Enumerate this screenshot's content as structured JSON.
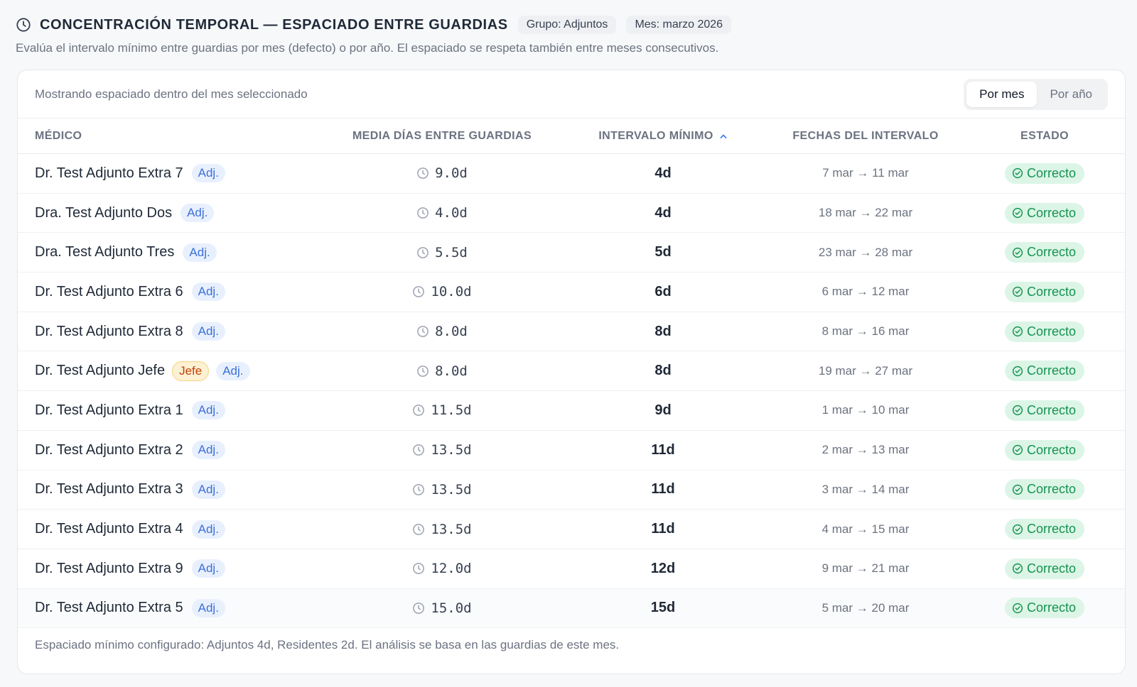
{
  "header": {
    "title": "Concentración temporal — Espaciado entre guardias",
    "group_pill": "Grupo: Adjuntos",
    "month_pill": "Mes: marzo 2026",
    "subtitle": "Evalúa el intervalo mínimo entre guardias por mes (defecto) o por año. El espaciado se respeta también entre meses consecutivos."
  },
  "card": {
    "info": "Mostrando espaciado dentro del mes seleccionado",
    "toggle": {
      "month_label": "Por mes",
      "year_label": "Por año",
      "selected": "Por mes"
    }
  },
  "table": {
    "columns": {
      "medico": "Médico",
      "media": "Media días entre guardias",
      "minimo": "Intervalo mínimo",
      "fechas": "Fechas del intervalo",
      "estado": "Estado"
    },
    "sort": {
      "column": "minimo",
      "direction": "asc"
    },
    "rows": [
      {
        "name": "Dr. Test Adjunto Extra 7",
        "badges": [
          "Adj."
        ],
        "media": "9.0d",
        "minimo": "4d",
        "fechas": "7 mar → 11 mar",
        "estado": "Correcto"
      },
      {
        "name": "Dra. Test Adjunto Dos",
        "badges": [
          "Adj."
        ],
        "media": "4.0d",
        "minimo": "4d",
        "fechas": "18 mar → 22 mar",
        "estado": "Correcto"
      },
      {
        "name": "Dra. Test Adjunto Tres",
        "badges": [
          "Adj."
        ],
        "media": "5.5d",
        "minimo": "5d",
        "fechas": "23 mar → 28 mar",
        "estado": "Correcto"
      },
      {
        "name": "Dr. Test Adjunto Extra 6",
        "badges": [
          "Adj."
        ],
        "media": "10.0d",
        "minimo": "6d",
        "fechas": "6 mar → 12 mar",
        "estado": "Correcto"
      },
      {
        "name": "Dr. Test Adjunto Extra 8",
        "badges": [
          "Adj."
        ],
        "media": "8.0d",
        "minimo": "8d",
        "fechas": "8 mar → 16 mar",
        "estado": "Correcto"
      },
      {
        "name": "Dr. Test Adjunto Jefe",
        "badges": [
          "Jefe",
          "Adj."
        ],
        "media": "8.0d",
        "minimo": "8d",
        "fechas": "19 mar → 27 mar",
        "estado": "Correcto"
      },
      {
        "name": "Dr. Test Adjunto Extra 1",
        "badges": [
          "Adj."
        ],
        "media": "11.5d",
        "minimo": "9d",
        "fechas": "1 mar → 10 mar",
        "estado": "Correcto"
      },
      {
        "name": "Dr. Test Adjunto Extra 2",
        "badges": [
          "Adj."
        ],
        "media": "13.5d",
        "minimo": "11d",
        "fechas": "2 mar → 13 mar",
        "estado": "Correcto"
      },
      {
        "name": "Dr. Test Adjunto Extra 3",
        "badges": [
          "Adj."
        ],
        "media": "13.5d",
        "minimo": "11d",
        "fechas": "3 mar → 14 mar",
        "estado": "Correcto"
      },
      {
        "name": "Dr. Test Adjunto Extra 4",
        "badges": [
          "Adj."
        ],
        "media": "13.5d",
        "minimo": "11d",
        "fechas": "4 mar → 15 mar",
        "estado": "Correcto"
      },
      {
        "name": "Dr. Test Adjunto Extra 9",
        "badges": [
          "Adj."
        ],
        "media": "12.0d",
        "minimo": "12d",
        "fechas": "9 mar → 21 mar",
        "estado": "Correcto"
      },
      {
        "name": "Dr. Test Adjunto Extra 5",
        "badges": [
          "Adj."
        ],
        "media": "15.0d",
        "minimo": "15d",
        "fechas": "5 mar → 20 mar",
        "estado": "Correcto"
      }
    ]
  },
  "footer": "Espaciado mínimo configurado: Adjuntos 4d, Residentes 2d. El análisis se basa en las guardias de este mes.",
  "colors": {
    "status_bg": "#dcf5e7",
    "status_text": "#15934f",
    "adj_bg": "#e8f0fe",
    "adj_text": "#3b6fd8",
    "jefe_bg": "#fdf1d3",
    "jefe_text": "#c2410c",
    "accent": "#3b82f6"
  }
}
